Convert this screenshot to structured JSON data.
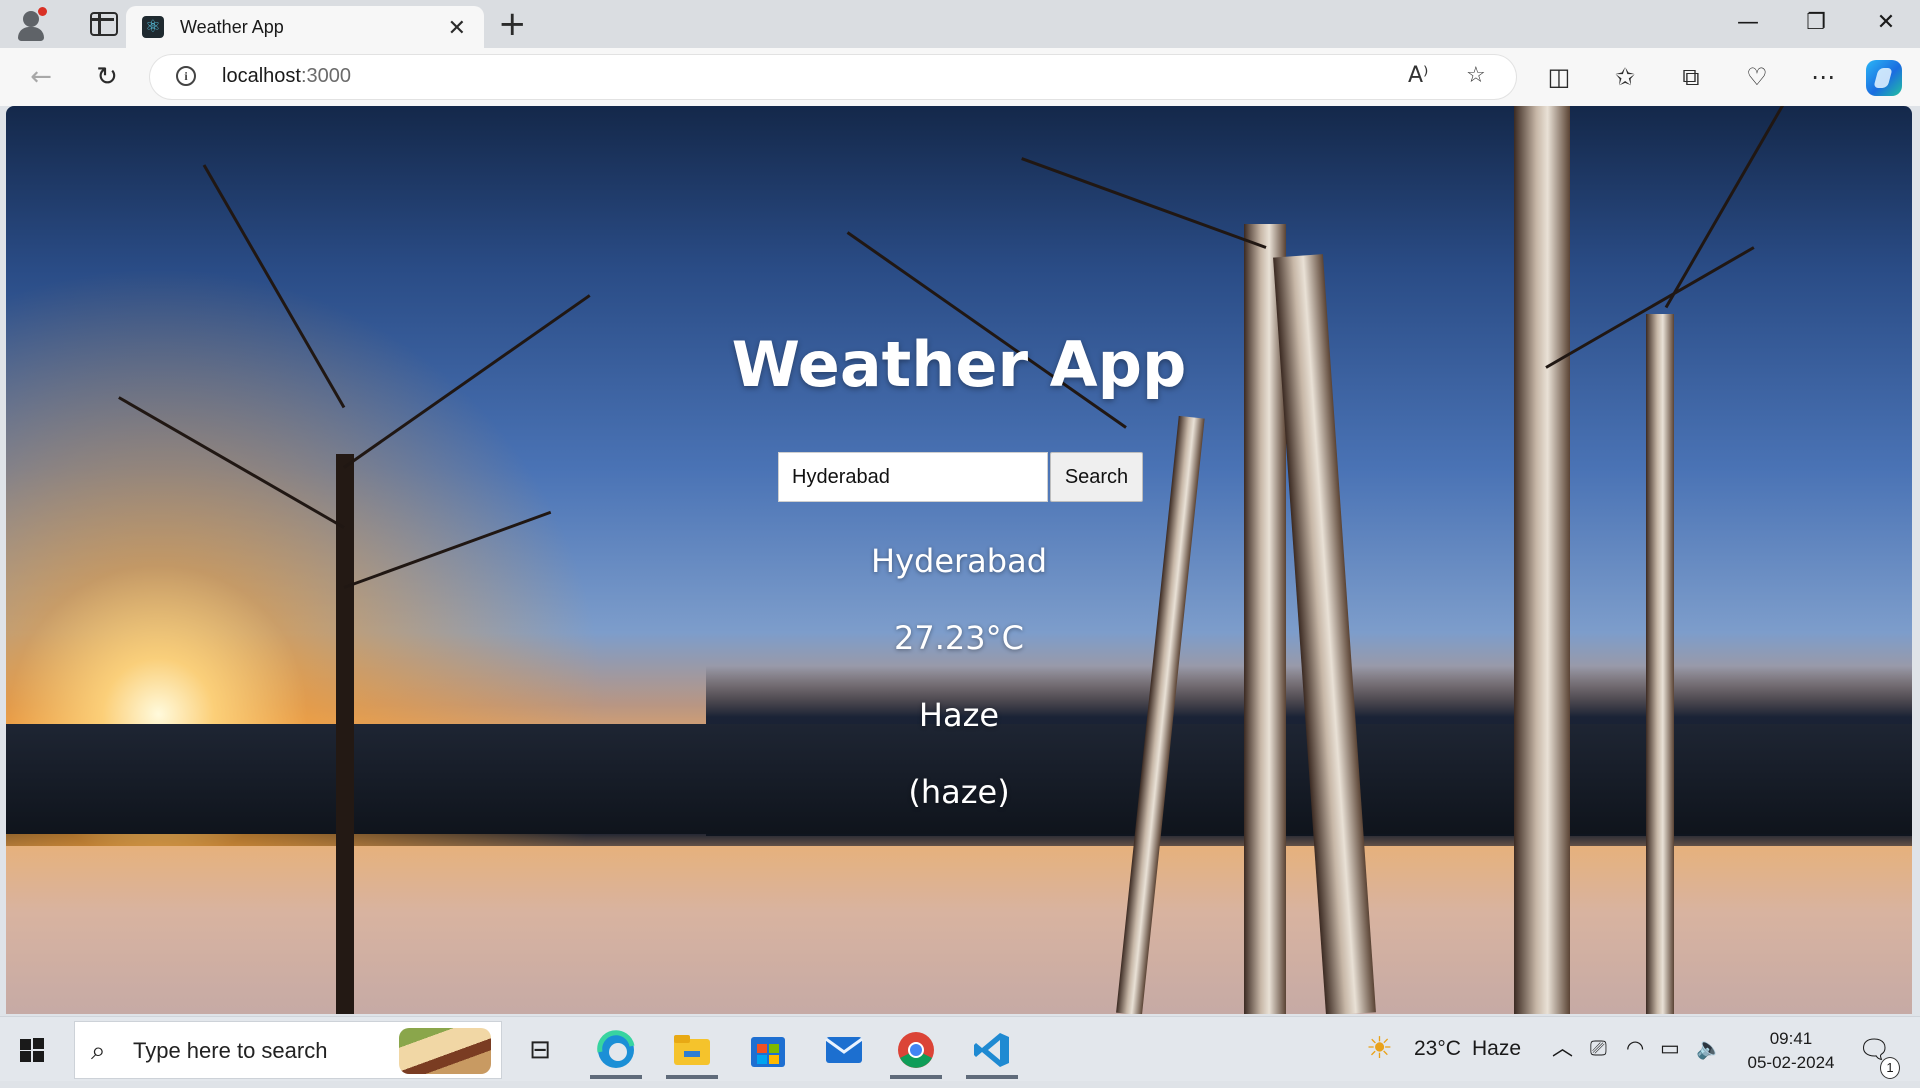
{
  "browser": {
    "tab_title": "Weather App",
    "url_host": "localhost",
    "url_port": ":3000",
    "new_tab_glyph": "+",
    "tab_close_glyph": "✕",
    "window_controls": {
      "minimize": "—",
      "restore": "❐",
      "close": "✕"
    },
    "nav": {
      "back": "←",
      "refresh": "↻"
    },
    "icons": [
      "read-aloud-icon",
      "favorite-star-icon",
      "split-screen-icon",
      "favorites-icon",
      "collections-icon",
      "browser-essentials-icon",
      "more-icon",
      "copilot-icon"
    ]
  },
  "app": {
    "title": "Weather App",
    "search": {
      "value": "Hyderabad",
      "button_label": "Search"
    },
    "result": {
      "city": "Hyderabad",
      "temperature": "27.23°C",
      "condition": "Haze",
      "description": "(haze)"
    }
  },
  "taskbar": {
    "search_placeholder": "Type here to search",
    "apps": [
      "task-view-icon",
      "edge-icon",
      "file-explorer-icon",
      "microsoft-store-icon",
      "mail-icon",
      "chrome-icon",
      "vscode-icon"
    ],
    "weather": {
      "temp": "23°C",
      "condition": "Haze"
    },
    "time": "09:41",
    "date": "05-02-2024",
    "notification_count": "1"
  },
  "colors": {
    "title_text": "#ffffff",
    "tab_bar": "#dadde1",
    "toolbar": "#f7f7f7",
    "taskbar": "#e3e7ec"
  }
}
